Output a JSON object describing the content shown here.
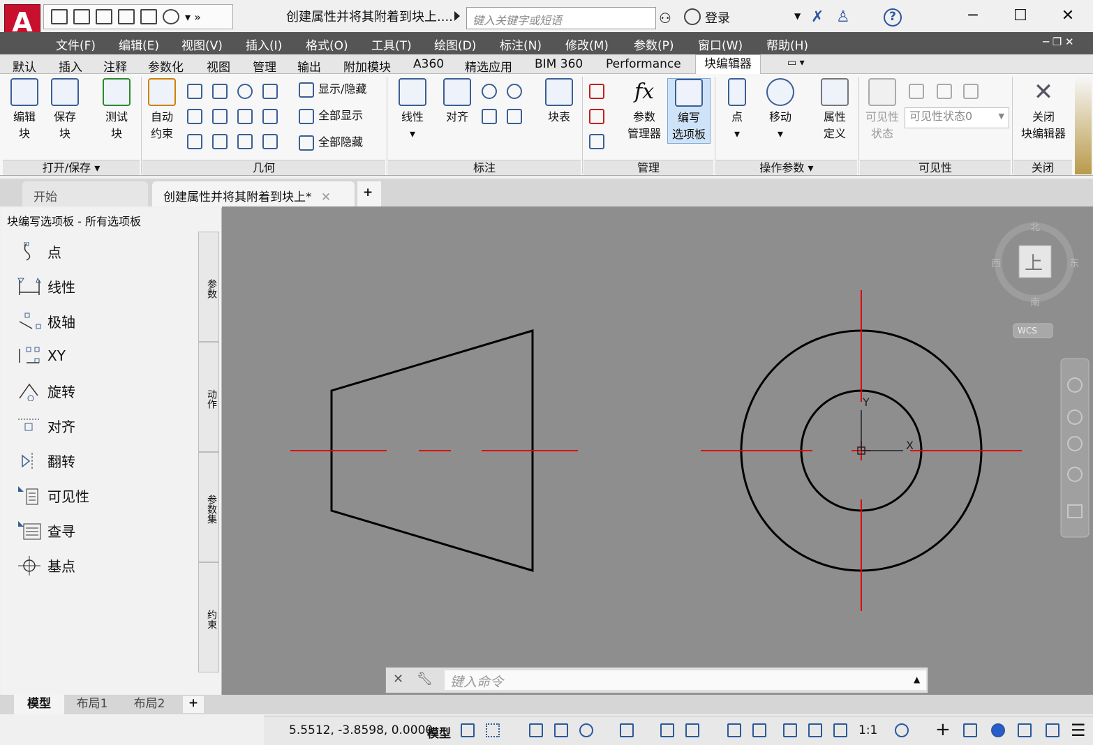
{
  "app": {
    "logo_letter": "A",
    "title": "创建属性并将其附着到块上....",
    "search_placeholder": "键入关键字或短语",
    "login_label": "登录",
    "help_label": "?"
  },
  "window_controls": {
    "minimize": "─",
    "maximize": "☐",
    "close": "✕"
  },
  "menubar": {
    "items": [
      "文件(F)",
      "编辑(E)",
      "视图(V)",
      "插入(I)",
      "格式(O)",
      "工具(T)",
      "绘图(D)",
      "标注(N)",
      "修改(M)",
      "参数(P)",
      "窗口(W)",
      "帮助(H)"
    ]
  },
  "ribbon_tabs": {
    "items": [
      "默认",
      "插入",
      "注释",
      "参数化",
      "视图",
      "管理",
      "输出",
      "附加模块",
      "A360",
      "精选应用",
      "BIM 360",
      "Performance",
      "块编辑器"
    ],
    "active": "块编辑器"
  },
  "ribbon": {
    "open_save": {
      "edit_block": "编辑\n块",
      "save_block": "保存\n块",
      "test_block": "测试\n块",
      "label": "打开/保存"
    },
    "geometry": {
      "auto_constrain": "自动\n约束",
      "show_hide": "显示/隐藏",
      "show_all": "全部显示",
      "hide_all": "全部隐藏",
      "label": "几何"
    },
    "dimension": {
      "linear": "线性",
      "aligned": "对齐",
      "block_table": "块表",
      "label": "标注"
    },
    "manage": {
      "param_manager": "参数\n管理器",
      "authoring_palette": "编写\n选项板",
      "label": "管理"
    },
    "action_params": {
      "point": "点",
      "move": "移动",
      "attr_def": "属性\n定义",
      "label": "操作参数"
    },
    "visibility": {
      "vis_state": "可见性\n状态",
      "vis_dropdown": "可见性状态0",
      "label": "可见性"
    },
    "close": {
      "close_editor": "关闭\n块编辑器",
      "label": "关闭"
    }
  },
  "doc_tabs": {
    "start": "开始",
    "active": "创建属性并将其附着到块上*"
  },
  "palette": {
    "title": "块编写选项板 - 所有选项板",
    "items": [
      "点",
      "线性",
      "极轴",
      "XY",
      "旋转",
      "对齐",
      "翻转",
      "可见性",
      "查寻",
      "基点"
    ],
    "side_tabs": [
      "参数",
      "动作",
      "参数集",
      "约束"
    ]
  },
  "viewcube": {
    "north": "北",
    "south": "南",
    "east": "东",
    "west": "西",
    "face": "上",
    "wcs": "WCS"
  },
  "ucs": {
    "x": "X",
    "y": "Y"
  },
  "command": {
    "placeholder": "键入命令"
  },
  "layout_tabs": [
    "模型",
    "布局1",
    "布局2"
  ],
  "status": {
    "coords": "5.5512, -3.8598, 0.0000",
    "model": "模型",
    "scale": "1:1"
  },
  "colors": {
    "menubar": "#555555",
    "canvas": "#8e8e8e",
    "centerline": "#e00000",
    "accent": "#3a5f95"
  }
}
